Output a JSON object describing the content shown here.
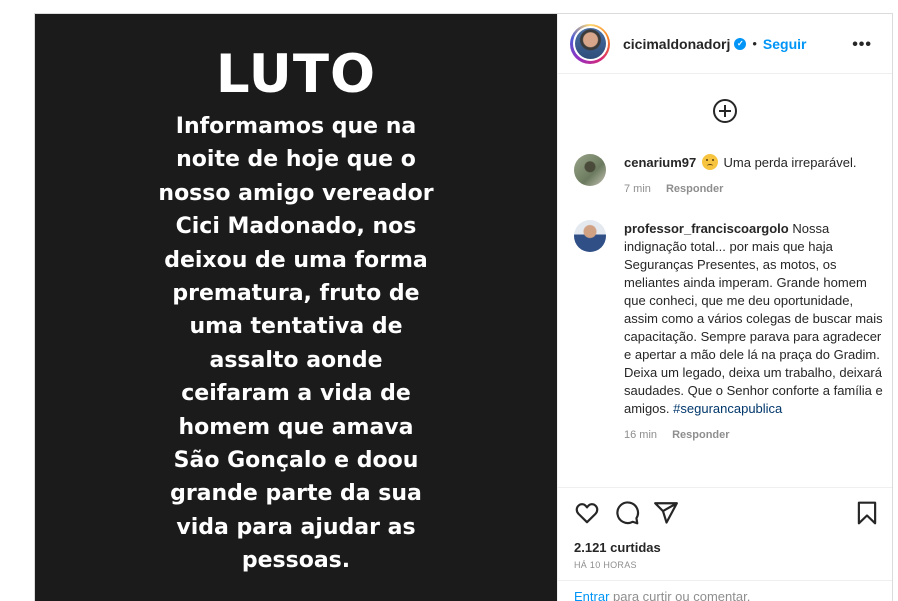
{
  "post": {
    "headline": "LUTO",
    "body_lines": [
      "Informamos que na",
      "noite de hoje que o",
      "nosso amigo vereador",
      "Cici Madonado, nos",
      "deixou de uma forma",
      "prematura, fruto de",
      "uma tentativa de",
      "assalto aonde",
      "ceifaram a vida de",
      "homem que amava",
      "São Gonçalo e doou",
      "grande parte da sua",
      "vida para ajudar as",
      "pessoas."
    ]
  },
  "header": {
    "username": "cicimaldonadorj",
    "separator": "•",
    "follow_label": "Seguir",
    "more_label": "•••"
  },
  "comments": [
    {
      "user": "cenarium97",
      "text": "Uma perda irreparável.",
      "time": "7 min",
      "reply_label": "Responder"
    },
    {
      "user": "professor_franciscoargolo",
      "text": "Nossa indignação total... por mais que haja Seguranças Presentes, as motos, os meliantes ainda imperam. Grande homem que conheci, que me deu oportunidade, assim como a vários colegas de buscar mais capacitação. Sempre parava para agradecer e apertar a mão dele lá na praça do Gradim. Deixa um legado, deixa um trabalho, deixará saudades. Que o Senhor conforte a família e amigos.",
      "hashtag": "#segurancapublica",
      "time": "16 min",
      "reply_label": "Responder"
    }
  ],
  "footer": {
    "likes": "2.121 curtidas",
    "timestamp": "HÁ 10 HORAS",
    "login_link": "Entrar",
    "login_prompt": "para curtir ou comentar."
  },
  "icons": {
    "like": "heart-icon",
    "comment": "comment-icon",
    "share": "share-icon",
    "save": "bookmark-icon",
    "add": "plus-circle-icon",
    "verified": "verified-icon",
    "more": "more-options-icon"
  },
  "colors": {
    "accent": "#0095f6",
    "post_background": "#1b1b1b",
    "text": "#262626",
    "muted": "#8e8e8e"
  }
}
